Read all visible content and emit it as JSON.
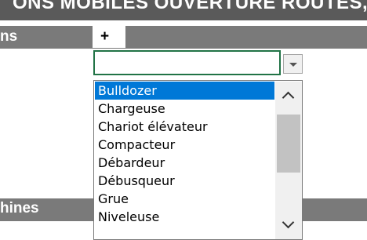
{
  "header": {
    "title": "ONS MOBILES OUVERTURE ROUTES,"
  },
  "section_top": {
    "label": "ns",
    "add_label": "+"
  },
  "section_bottom": {
    "label": "hines"
  },
  "combo": {
    "value": ""
  },
  "dropdown": {
    "selected_index": 0,
    "items": [
      "Bulldozer",
      "Chargeuse",
      "Chariot élévateur",
      "Compacteur",
      "Débardeur",
      "Débusqueur",
      "Grue",
      "Niveleuse"
    ]
  },
  "icons": {
    "combo_arrow": "chevron-down-icon",
    "scroll_up": "chevron-up-icon",
    "scroll_down": "chevron-down-icon"
  },
  "colors": {
    "selected_bg": "#0078d7",
    "active_border": "#217346",
    "header_dark": "#5a5a5a",
    "header_gray": "#7a7a7a"
  }
}
